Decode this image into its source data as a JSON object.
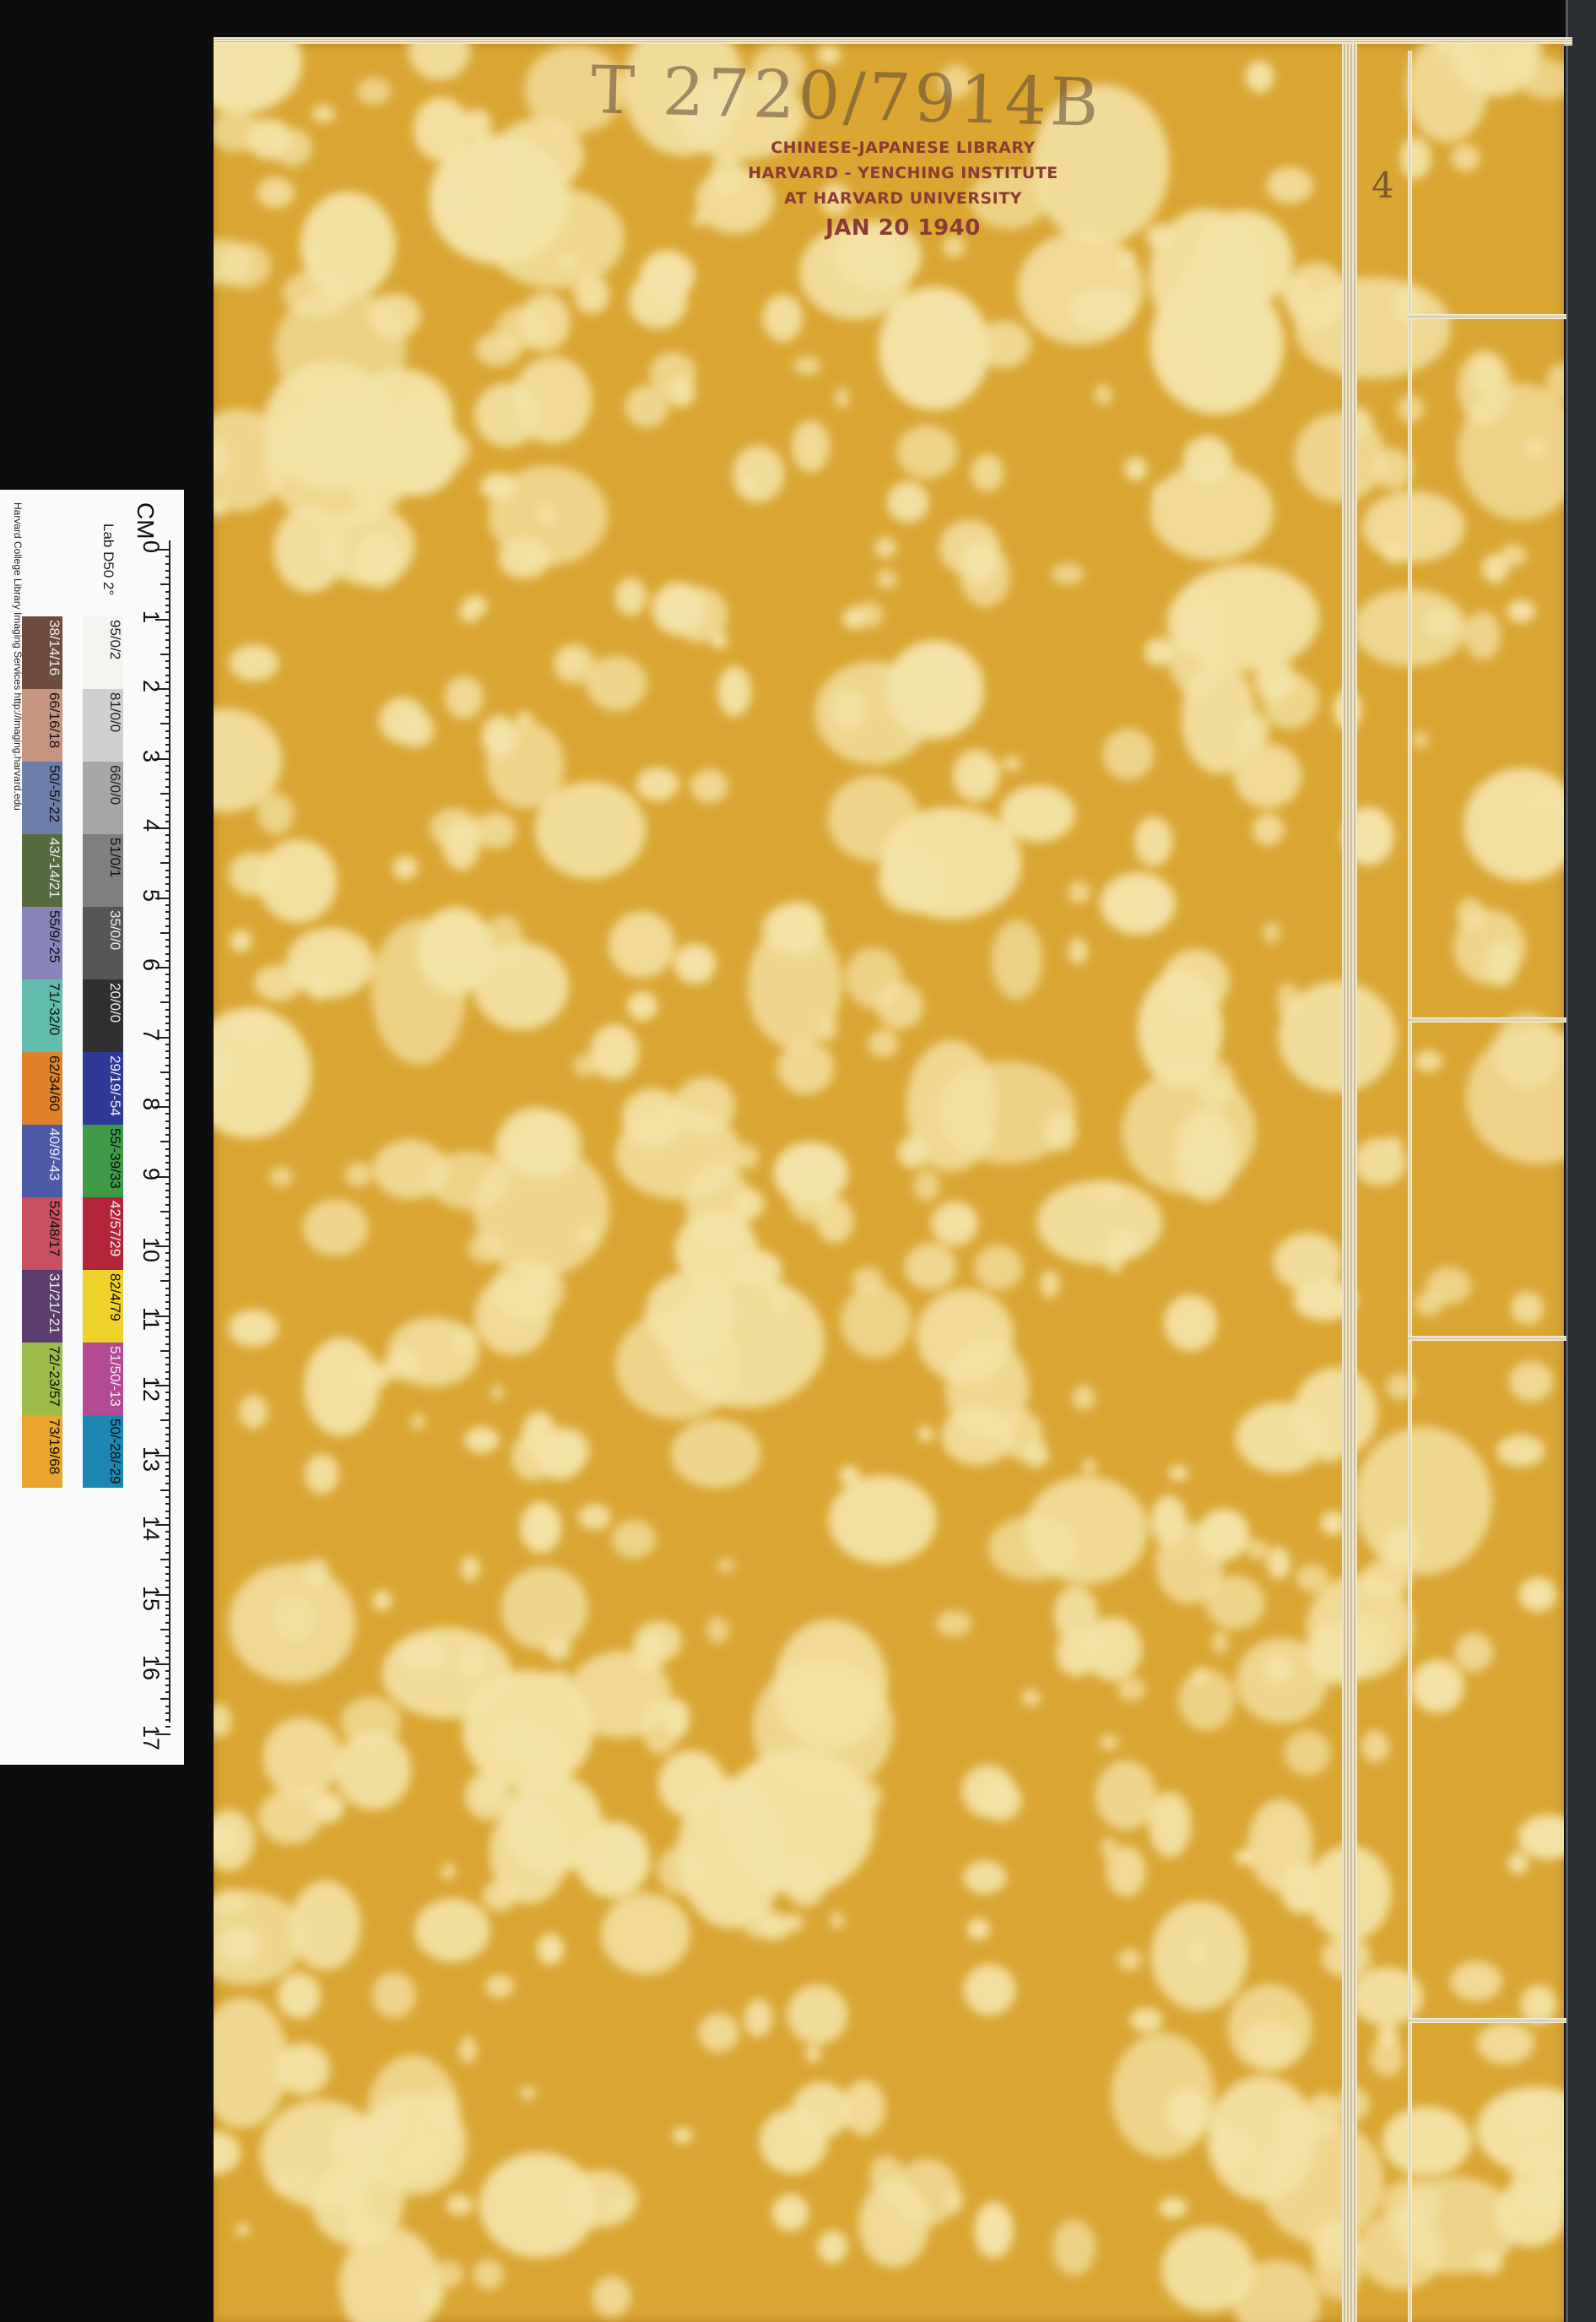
{
  "cover": {
    "call_number": "T 2720/7914B",
    "stamp": {
      "line1": "CHINESE-JAPANESE LIBRARY",
      "line2": "HARVARD - YENCHING INSTITUTE",
      "line3": "AT HARVARD UNIVERSITY",
      "date": "JAN 20 1940"
    },
    "volume_number": "4",
    "colors": {
      "cover_base": "#d9a632",
      "spot_light": "#f4e3a8",
      "stamp_ink": "#8a3b33"
    }
  },
  "color_target": {
    "credit": "Harvard College Library Imaging Services http://imaging.harvard.edu",
    "lab_label": "Lab D50 2°",
    "ruler_unit": "CM",
    "cm_labels": [
      "0",
      "1",
      "2",
      "3",
      "4",
      "5",
      "6",
      "7",
      "8",
      "9",
      "10",
      "11",
      "12",
      "13",
      "14",
      "15",
      "16",
      "17"
    ],
    "gray_patches": [
      {
        "label": "95/0/2",
        "color": "#f3f3f0",
        "text_color": "#222"
      },
      {
        "label": "81/0/0",
        "color": "#cfcfcd",
        "text_color": "#222"
      },
      {
        "label": "66/0/0",
        "color": "#a6a6a4",
        "text_color": "#222"
      },
      {
        "label": "51/0/1",
        "color": "#7f7f7e",
        "text_color": "#111"
      },
      {
        "label": "35/0/0",
        "color": "#565656",
        "text_color": "#eee"
      },
      {
        "label": "20/0/0",
        "color": "#303030",
        "text_color": "#eee"
      },
      {
        "label": "29/19/-54",
        "color": "#2f3a98",
        "text_color": "#eee"
      },
      {
        "label": "55/-39/33",
        "color": "#3f9a48",
        "text_color": "#111"
      },
      {
        "label": "42/57/29",
        "color": "#b3263a",
        "text_color": "#eee"
      },
      {
        "label": "82/4/79",
        "color": "#edd22a",
        "text_color": "#111"
      },
      {
        "label": "51/50/-13",
        "color": "#b34a93",
        "text_color": "#eee"
      },
      {
        "label": "50/-28/-29",
        "color": "#1b86b1",
        "text_color": "#111"
      }
    ],
    "color_patches": [
      {
        "label": "38/14/16",
        "color": "#6e4c3d",
        "text_color": "#eee"
      },
      {
        "label": "66/16/18",
        "color": "#c69580",
        "text_color": "#111"
      },
      {
        "label": "50/-5/-22",
        "color": "#6b7fa9",
        "text_color": "#111"
      },
      {
        "label": "43/-14/21",
        "color": "#566b3f",
        "text_color": "#eee"
      },
      {
        "label": "55/9/-25",
        "color": "#8884b9",
        "text_color": "#111"
      },
      {
        "label": "71/-32/0",
        "color": "#61bcac",
        "text_color": "#111"
      },
      {
        "label": "62/34/60",
        "color": "#e0822a",
        "text_color": "#111"
      },
      {
        "label": "40/9/-43",
        "color": "#4c5aa8",
        "text_color": "#eee"
      },
      {
        "label": "52/48/17",
        "color": "#c9505f",
        "text_color": "#111"
      },
      {
        "label": "31/21/-21",
        "color": "#5b3c6d",
        "text_color": "#eee"
      },
      {
        "label": "72/-23/57",
        "color": "#9cbb48",
        "text_color": "#111"
      },
      {
        "label": "73/19/68",
        "color": "#e9a52c",
        "text_color": "#111"
      }
    ]
  }
}
